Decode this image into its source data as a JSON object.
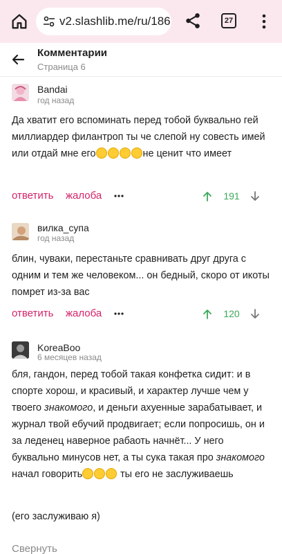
{
  "browser": {
    "url": "v2.slashlib.me/ru/186",
    "tab_count": "27"
  },
  "header": {
    "title": "Комментарии",
    "subtitle": "Страница 6"
  },
  "actions": {
    "reply_label": "ответить",
    "report_label": "жалоба"
  },
  "comments": [
    {
      "author": "Bandai",
      "time": "год назад",
      "text_before": "Да хватит его вспоминать перед тобой буквально гей миллиардер филантроп ты че слепой ну совесть имей или отдай мне его",
      "emoji": "eye-roll-emoji",
      "text_after": "не ценит что имеет",
      "score": "191"
    },
    {
      "author": "вилка_супа",
      "time": "год назад",
      "text": "блин, чуваки, перестаньте сравнивать друг друга с одним и тем же человеком... он бедный, скоро от икоты помрет из-за вас",
      "score": "120"
    },
    {
      "author": "KoreaBoo",
      "time": "6 месяцев назад",
      "p1_a": "бля, гандон, перед тобой такая конфетка сидит: и в спорте хорош, и красивый, и характер лучше чем у твоего ",
      "p1_em1": "знакомого",
      "p1_b": ", и деньги ахуенные зарабатывает, и журнал твой ебучий продвигает; если попросишь, он и за леденец наверное рабаоть начнёт... У него буквально минусов нет, а ты сука такая про ",
      "p1_em2": "знакомого",
      "p1_c": " начал говорить",
      "emoji": "crying-emoji",
      "p1_d": " ты его не заслуживаешь",
      "p2": "(его заслуживаю я)"
    }
  ],
  "collapse_label": "Свернуть",
  "colors": {
    "accent": "#d4226a",
    "upvote": "#3aa95a",
    "chrome_bg": "#fbe8ef"
  }
}
